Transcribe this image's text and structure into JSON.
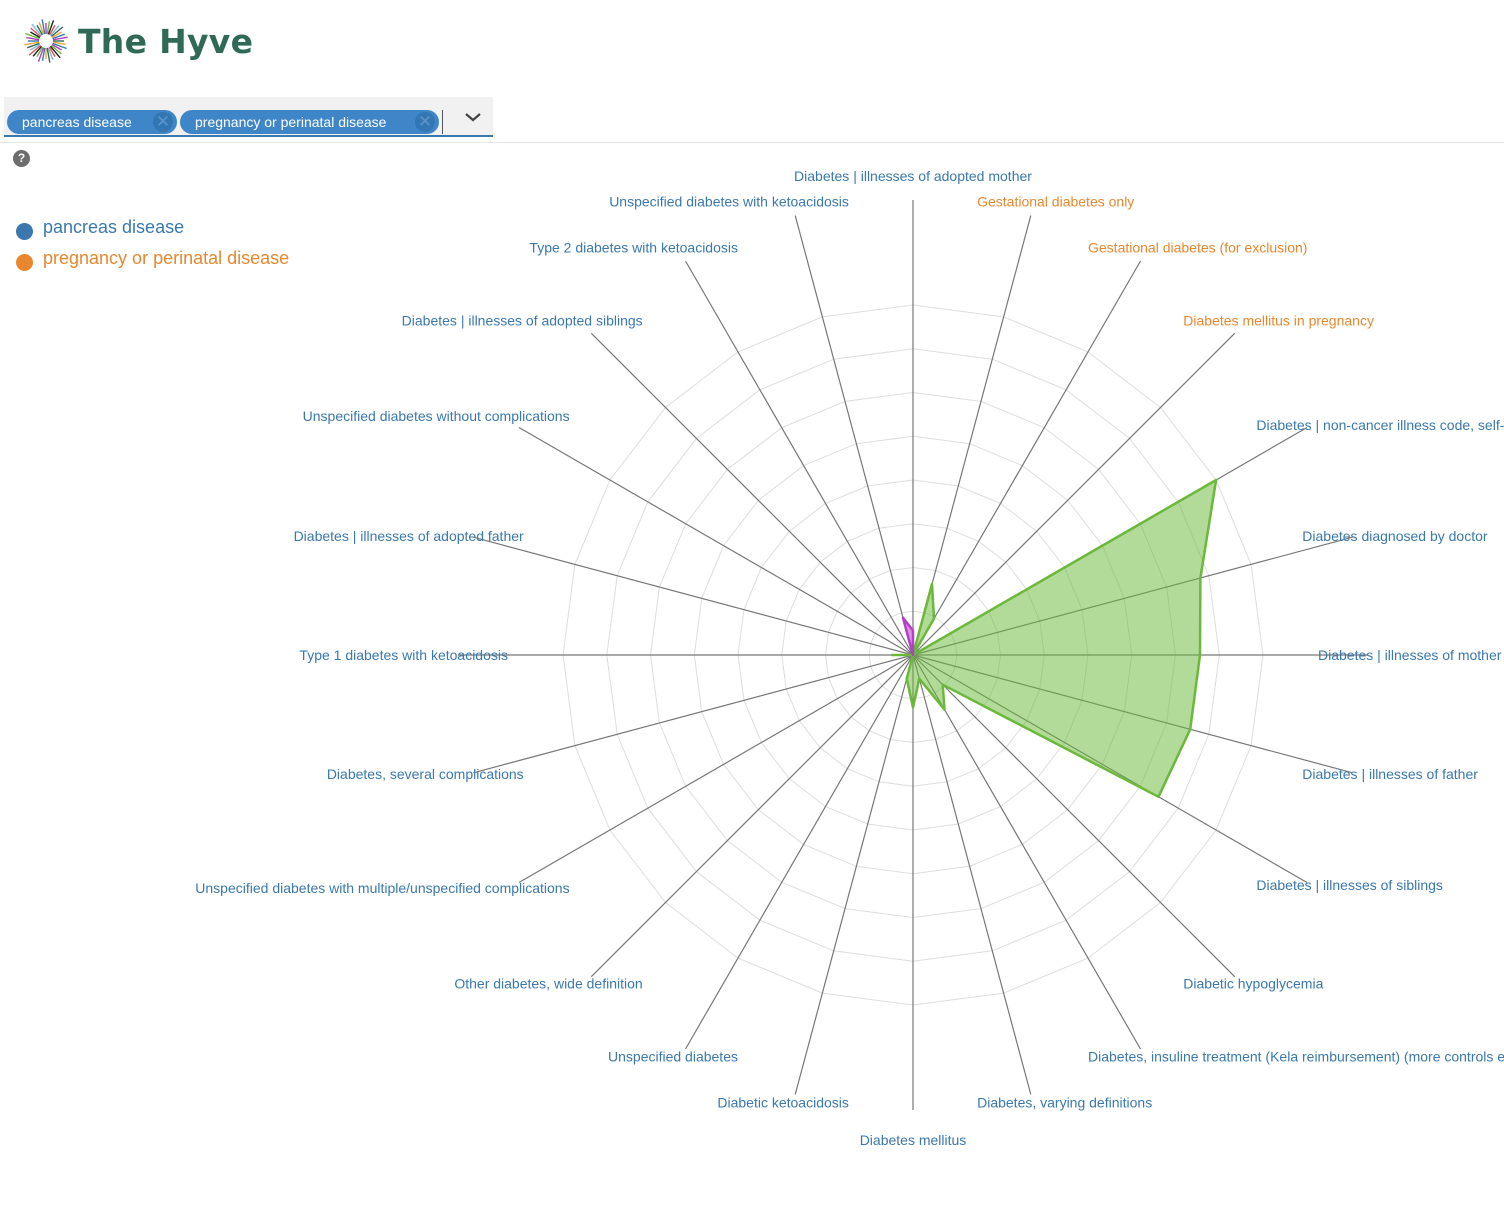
{
  "brand": {
    "name": "The Hyve"
  },
  "selector": {
    "tags": [
      {
        "label": "pancreas disease",
        "remove_icon": "close-icon"
      },
      {
        "label": "pregnancy or perinatal disease",
        "remove_icon": "close-icon"
      }
    ],
    "dropdown_icon": "chevron-down-icon"
  },
  "help": {
    "icon": "help-icon",
    "glyph": "?"
  },
  "legend": [
    {
      "label": "pancreas disease",
      "color": "#3a78ae"
    },
    {
      "label": "pregnancy or perinatal disease",
      "color": "#e8872e"
    }
  ],
  "chart_data": {
    "type": "radar",
    "max": 1.0,
    "rings": 8,
    "axes": [
      {
        "label": "Diabetes | illnesses of adopted mother",
        "category": "pancreas disease"
      },
      {
        "label": "Gestational diabetes only",
        "category": "pregnancy or perinatal disease"
      },
      {
        "label": "Gestational diabetes (for exclusion)",
        "category": "pregnancy or perinatal disease"
      },
      {
        "label": "Diabetes mellitus in pregnancy",
        "category": "pregnancy or perinatal disease"
      },
      {
        "label": "Diabetes | non-cancer illness code, self-reported",
        "category": "pancreas disease"
      },
      {
        "label": "Diabetes diagnosed by doctor",
        "category": "pancreas disease"
      },
      {
        "label": "Diabetes | illnesses of mother",
        "category": "pancreas disease"
      },
      {
        "label": "Diabetes | illnesses of father",
        "category": "pancreas disease"
      },
      {
        "label": "Diabetes | illnesses of siblings",
        "category": "pancreas disease"
      },
      {
        "label": "Diabetic hypoglycemia",
        "category": "pancreas disease"
      },
      {
        "label": "Diabetes, insuline treatment (Kela reimbursement) (more controls excluded)",
        "category": "pancreas disease"
      },
      {
        "label": "Diabetes, varying definitions",
        "category": "pancreas disease"
      },
      {
        "label": "Diabetes mellitus",
        "category": "pancreas disease"
      },
      {
        "label": "Diabetic ketoacidosis",
        "category": "pancreas disease"
      },
      {
        "label": "Unspecified diabetes",
        "category": "pancreas disease"
      },
      {
        "label": "Other diabetes, wide definition",
        "category": "pancreas disease"
      },
      {
        "label": "Unspecified diabetes with multiple/unspecified complications",
        "category": "pancreas disease"
      },
      {
        "label": "Diabetes, several complications",
        "category": "pancreas disease"
      },
      {
        "label": "Type 1 diabetes with ketoacidosis",
        "category": "pancreas disease"
      },
      {
        "label": "Diabetes | illnesses of adopted father",
        "category": "pancreas disease"
      },
      {
        "label": "Unspecified diabetes without complications",
        "category": "pancreas disease"
      },
      {
        "label": "Diabetes | illnesses of adopted siblings",
        "category": "pancreas disease"
      },
      {
        "label": "Type 2 diabetes with ketoacidosis",
        "category": "pancreas disease"
      },
      {
        "label": "Unspecified diabetes with ketoacidosis",
        "category": "pancreas disease"
      }
    ],
    "series": [
      {
        "color": "#6bb83a",
        "values": [
          0.0,
          0.21,
          0.12,
          0.0,
          1.0,
          0.85,
          0.82,
          0.82,
          0.81,
          0.12,
          0.18,
          0.07,
          0.15,
          0.07,
          0.0,
          0.0,
          0.0,
          0.0,
          0.06,
          0.0,
          0.0,
          0.0,
          0.0,
          0.0
        ]
      },
      {
        "color": "#b43fc8",
        "values": [
          0.07,
          0.0,
          0.0,
          0.0,
          0.0,
          0.0,
          0.0,
          0.0,
          0.0,
          0.0,
          0.0,
          0.0,
          0.0,
          0.0,
          0.0,
          0.0,
          0.0,
          0.0,
          0.0,
          0.0,
          0.0,
          0.0,
          0.0,
          0.11
        ]
      }
    ]
  }
}
